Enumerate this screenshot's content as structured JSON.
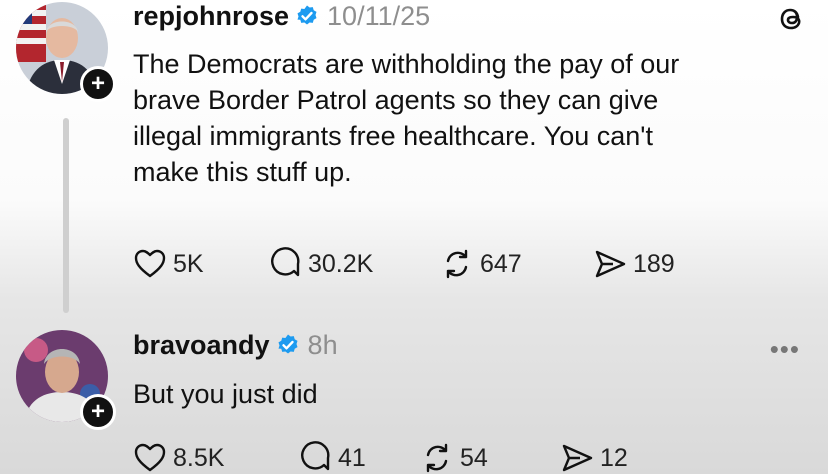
{
  "posts": [
    {
      "username": "repjohnrose",
      "timestamp": "10/11/25",
      "text_lines": [
        "The Democrats are withholding the pay of our",
        "brave Border Patrol agents so they can give",
        "illegal immigrants free healthcare. You can't",
        "make this stuff up."
      ],
      "likes": "5K",
      "replies": "30.2K",
      "reposts": "647",
      "shares": "189"
    },
    {
      "username": "bravoandy",
      "timestamp": "8h",
      "text_lines": [
        "But you just did"
      ],
      "likes": "8.5K",
      "replies": "41",
      "reposts": "54",
      "shares": "12"
    }
  ],
  "icons": {
    "verified": "verified-badge-icon",
    "threads": "threads-logo-icon",
    "like": "heart-icon",
    "reply": "comment-icon",
    "repost": "repost-icon",
    "share": "send-icon",
    "more": "more-dots-icon",
    "follow": "plus-icon"
  },
  "colors": {
    "verified": "#1d9bf0",
    "muted": "#8e8e8e",
    "text": "#111111"
  },
  "more_label": "•••",
  "follow_label": "+"
}
